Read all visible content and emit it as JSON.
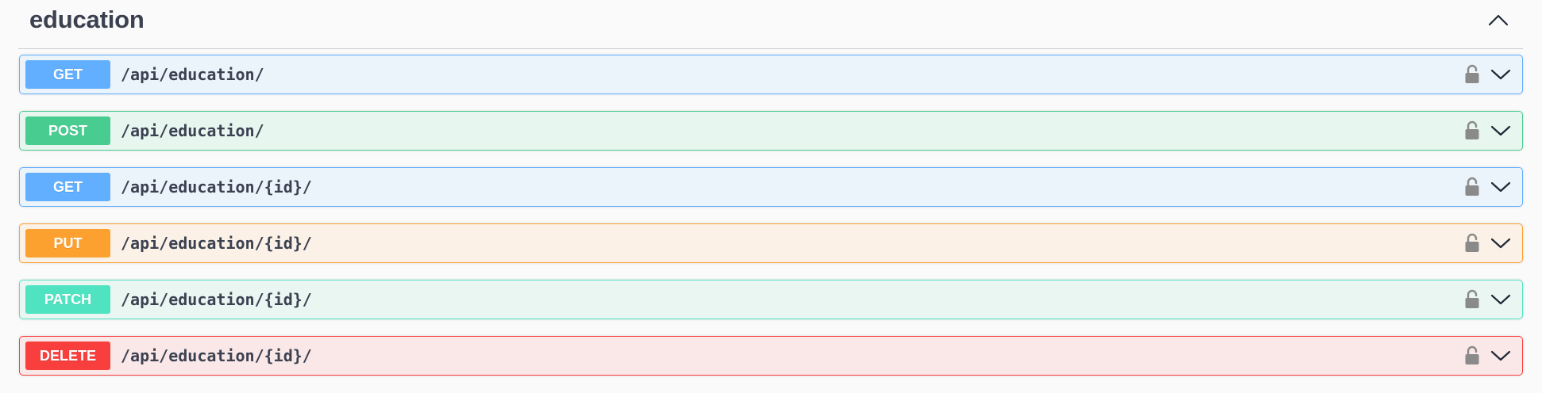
{
  "section": {
    "title": "education",
    "toggle_icon": "chevron-up-icon"
  },
  "operations": [
    {
      "method": "GET",
      "path": "/api/education/",
      "method_color": "#61affe",
      "bg_color": "#ebf3fb",
      "border_color": "#61affe"
    },
    {
      "method": "POST",
      "path": "/api/education/",
      "method_color": "#49cc90",
      "bg_color": "#e8f6f0",
      "border_color": "#49cc90"
    },
    {
      "method": "GET",
      "path": "/api/education/{id}/",
      "method_color": "#61affe",
      "bg_color": "#ebf3fb",
      "border_color": "#61affe"
    },
    {
      "method": "PUT",
      "path": "/api/education/{id}/",
      "method_color": "#fca130",
      "bg_color": "#fbf1e6",
      "border_color": "#fca130"
    },
    {
      "method": "PATCH",
      "path": "/api/education/{id}/",
      "method_color": "#50e3c2",
      "bg_color": "#e9f6f1",
      "border_color": "#50e3c2"
    },
    {
      "method": "DELETE",
      "path": "/api/education/{id}/",
      "method_color": "#f93e3e",
      "bg_color": "#fae7e7",
      "border_color": "#f93e3e"
    }
  ],
  "icons": {
    "lock": "lock-icon",
    "expand": "chevron-down-icon"
  }
}
